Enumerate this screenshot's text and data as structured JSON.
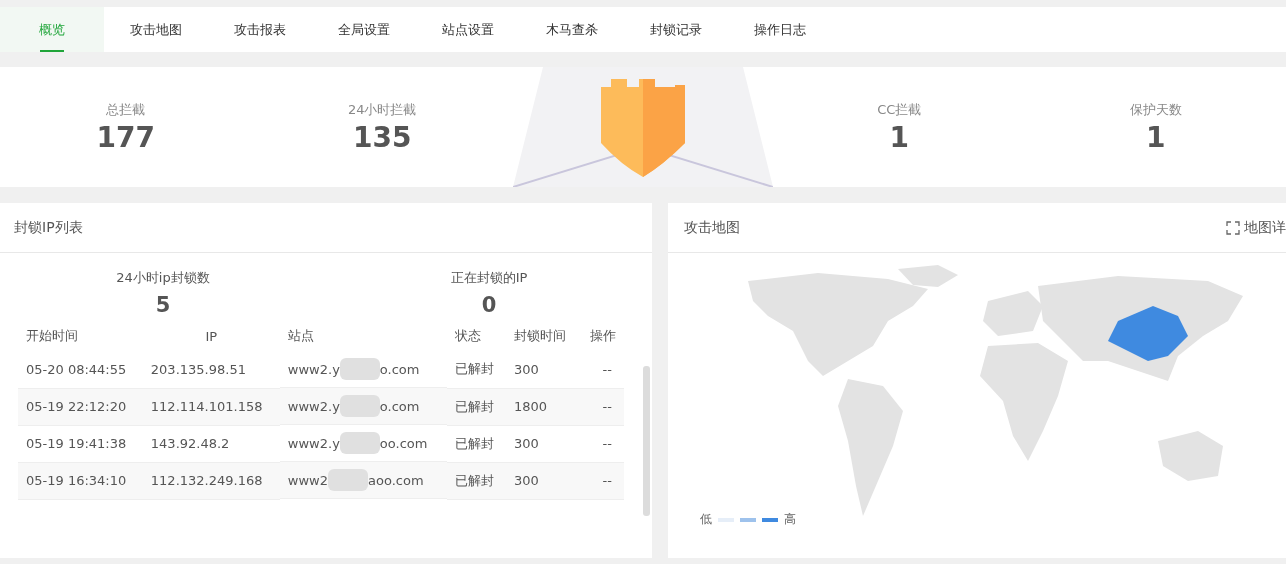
{
  "tabs": [
    {
      "label": "概览",
      "selected": true
    },
    {
      "label": "攻击地图",
      "selected": false
    },
    {
      "label": "攻击报表",
      "selected": false
    },
    {
      "label": "全局设置",
      "selected": false
    },
    {
      "label": "站点设置",
      "selected": false
    },
    {
      "label": "木马查杀",
      "selected": false
    },
    {
      "label": "封锁记录",
      "selected": false
    },
    {
      "label": "操作日志",
      "selected": false
    }
  ],
  "stats_left": [
    {
      "label": "总拦截",
      "value": "177"
    },
    {
      "label": "24小时拦截",
      "value": "135"
    }
  ],
  "stats_right": [
    {
      "label": "CC拦截",
      "value": "1"
    },
    {
      "label": "保护天数",
      "value": "1"
    }
  ],
  "blocked_ip_panel": {
    "title": "封锁IP列表",
    "summary": [
      {
        "label": "24小时ip封锁数",
        "value": "5"
      },
      {
        "label": "正在封锁的IP",
        "value": "0"
      }
    ],
    "columns": [
      "开始时间",
      "IP",
      "站点",
      "状态",
      "封锁时间",
      "操作"
    ],
    "rows": [
      {
        "start": "05-20 08:44:55",
        "ip": "203.135.98.51",
        "site_start": "www2.y",
        "site_end": "o.com",
        "status": "已解封",
        "duration": "300",
        "action": "--"
      },
      {
        "start": "05-19 22:12:20",
        "ip": "112.114.101.158",
        "site_start": "www2.y",
        "site_end": "o.com",
        "status": "已解封",
        "duration": "1800",
        "action": "--"
      },
      {
        "start": "05-19 19:41:38",
        "ip": "143.92.48.2",
        "site_start": "www2.y",
        "site_end": "oo.com",
        "status": "已解封",
        "duration": "300",
        "action": "--"
      },
      {
        "start": "05-19 16:34:10",
        "ip": "112.132.249.168",
        "site_start": "www2",
        "site_end": "aoo.com",
        "status": "已解封",
        "duration": "300",
        "action": "--"
      }
    ]
  },
  "attack_map_panel": {
    "title": "攻击地图",
    "detail_link": "地图详",
    "legend": {
      "low": "低",
      "high": "高"
    }
  }
}
